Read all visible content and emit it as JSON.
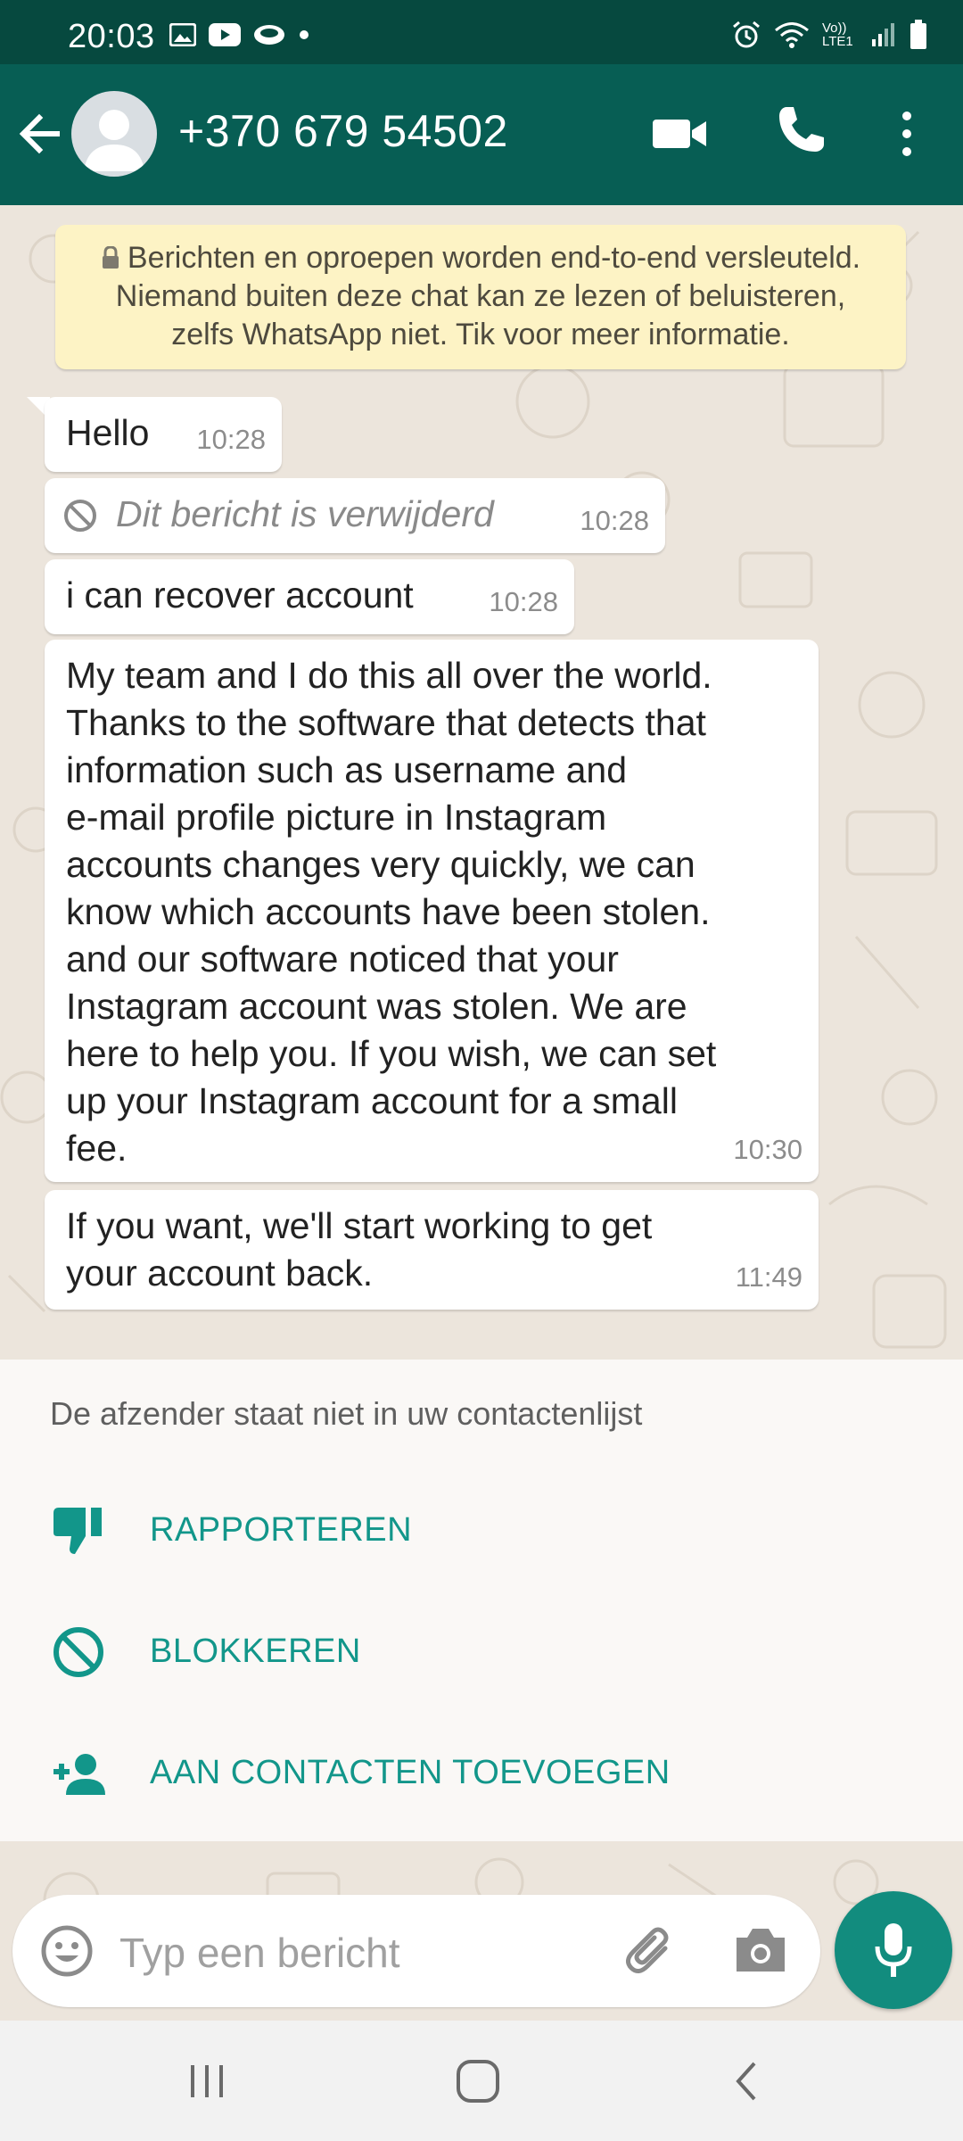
{
  "status_bar": {
    "time": "20:03",
    "network_label": "Vo)) LTE1",
    "icons": [
      "gallery-icon",
      "youtube-icon",
      "app-icon",
      "dot-icon",
      "alarm-icon",
      "wifi-icon",
      "signal-icon",
      "battery-icon"
    ]
  },
  "header": {
    "contact": "+370 679 54502",
    "icons": [
      "back-arrow-icon",
      "avatar",
      "video-call-icon",
      "phone-call-icon",
      "more-options-icon"
    ],
    "colors": {
      "toolbar": "#075e54",
      "status_bar": "#06493f"
    }
  },
  "encryption_notice": {
    "line1": "Berichten en oproepen worden end-to-end versleuteld.",
    "line2": "Niemand buiten deze chat kan ze lezen of beluisteren,",
    "line3": "zelfs WhatsApp niet. Tik voor meer informatie."
  },
  "messages": [
    {
      "text": "Hello",
      "time": "10:28"
    },
    {
      "text": "Dit bericht is verwijderd",
      "time": "10:28",
      "deleted": true
    },
    {
      "text": "i can recover account",
      "time": "10:28"
    },
    {
      "lines": [
        "My team and I do this all over the world.",
        "Thanks to the software that detects that",
        "information such as username and",
        "e-mail profile picture in Instagram",
        "accounts changes very quickly, we can",
        "know which accounts have been stolen.",
        "and our software noticed that your",
        "Instagram account was stolen. We are",
        "here to help you. If you wish, we can set",
        "up your Instagram account for a small",
        "fee."
      ],
      "time": "10:30"
    },
    {
      "lines": [
        "If you want, we'll start working to get",
        "your account back."
      ],
      "time": "11:49"
    }
  ],
  "unknown_sender": {
    "label": "De afzender staat niet in uw contactenlijst",
    "actions": [
      {
        "label": "RAPPORTEREN",
        "icon": "thumbs-down-icon"
      },
      {
        "label": "BLOKKEREN",
        "icon": "block-icon"
      },
      {
        "label": "AAN CONTACTEN TOEVOEGEN",
        "icon": "add-contact-icon"
      }
    ],
    "accent": "#12968a"
  },
  "composer": {
    "placeholder": "Typ een bericht",
    "icons": [
      "emoji-icon",
      "attach-icon",
      "camera-icon",
      "mic-icon"
    ],
    "mic_color": "#128c7e"
  },
  "nav_bar": {
    "icons": [
      "recent-apps-icon",
      "home-icon",
      "back-icon"
    ]
  }
}
